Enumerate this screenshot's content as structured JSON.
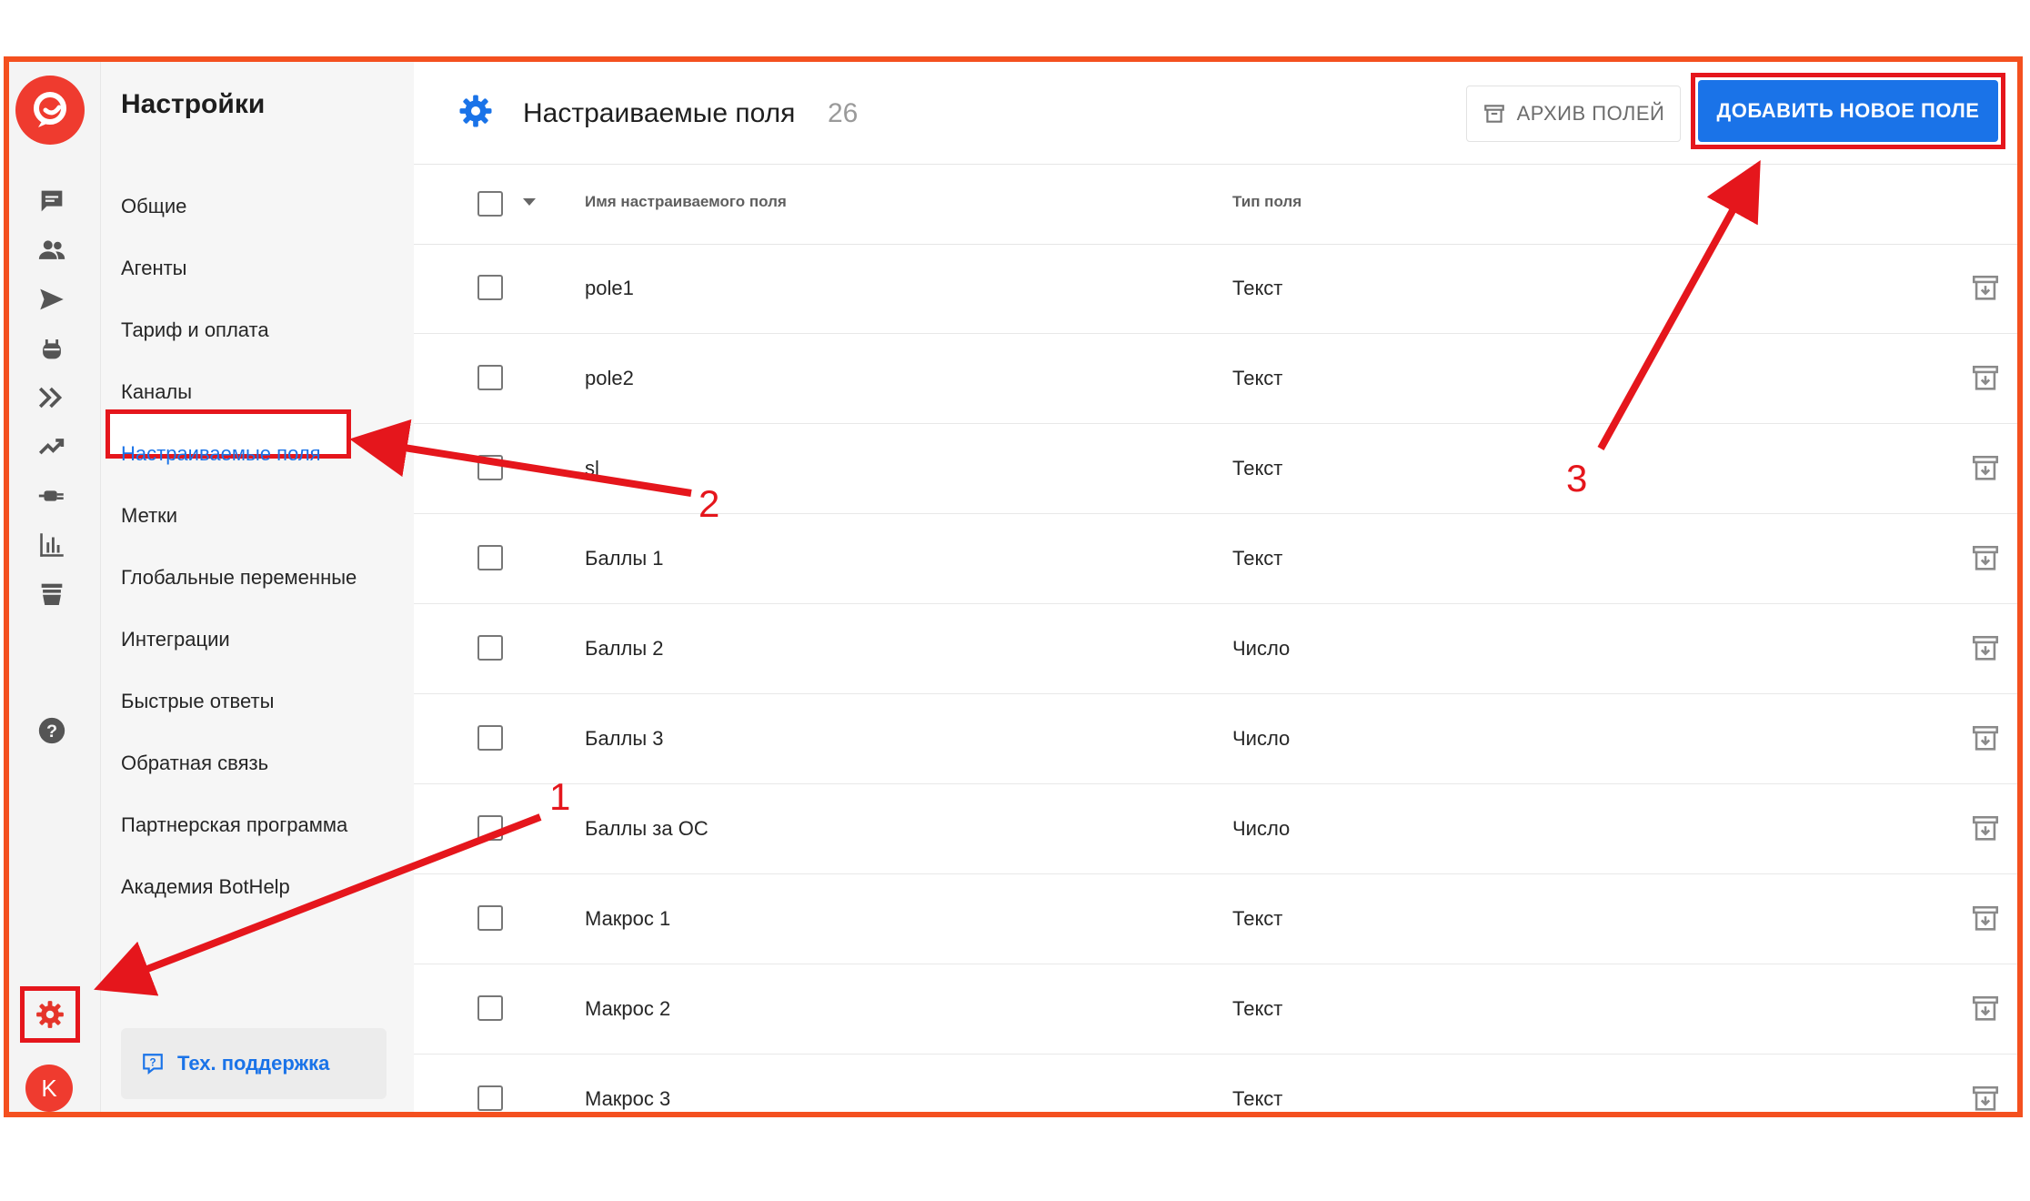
{
  "app": {
    "logo_name": "bothelp-logo",
    "avatar_letter": "K"
  },
  "nav": {
    "title": "Настройки",
    "items": [
      {
        "label": "Общие",
        "active": false
      },
      {
        "label": "Агенты",
        "active": false
      },
      {
        "label": "Тариф и оплата",
        "active": false
      },
      {
        "label": "Каналы",
        "active": false
      },
      {
        "label": "Настраиваемые поля",
        "active": true
      },
      {
        "label": "Метки",
        "active": false
      },
      {
        "label": "Глобальные переменные",
        "active": false
      },
      {
        "label": "Интеграции",
        "active": false
      },
      {
        "label": "Быстрые ответы",
        "active": false
      },
      {
        "label": "Обратная связь",
        "active": false
      },
      {
        "label": "Партнерская программа",
        "active": false
      },
      {
        "label": "Академия BotHelp",
        "active": false
      }
    ],
    "support_label": "Тех. поддержка"
  },
  "header": {
    "title": "Настраиваемые поля",
    "count": "26",
    "archive_label": "АРХИВ ПОЛЕЙ",
    "add_label": "ДОБАВИТЬ НОВОЕ ПОЛЕ"
  },
  "table": {
    "columns": [
      "Имя настраиваемого поля",
      "Тип поля"
    ],
    "rows": [
      {
        "name": "pole1",
        "type": "Текст"
      },
      {
        "name": "pole2",
        "type": "Текст"
      },
      {
        "name": "sl",
        "type": "Текст"
      },
      {
        "name": "Баллы 1",
        "type": "Текст"
      },
      {
        "name": "Баллы 2",
        "type": "Число"
      },
      {
        "name": "Баллы 3",
        "type": "Число"
      },
      {
        "name": "Баллы за ОС",
        "type": "Число"
      },
      {
        "name": "Макрос 1",
        "type": "Текст"
      },
      {
        "name": "Макрос 2",
        "type": "Текст"
      },
      {
        "name": "Макрос 3",
        "type": "Текст"
      }
    ]
  },
  "annotations": {
    "n1": "1",
    "n2": "2",
    "n3": "3"
  },
  "colors": {
    "accent": "#1a73e8",
    "brand": "#ef3b2f",
    "annotation": "#e5161c",
    "frame": "#f4501f"
  }
}
